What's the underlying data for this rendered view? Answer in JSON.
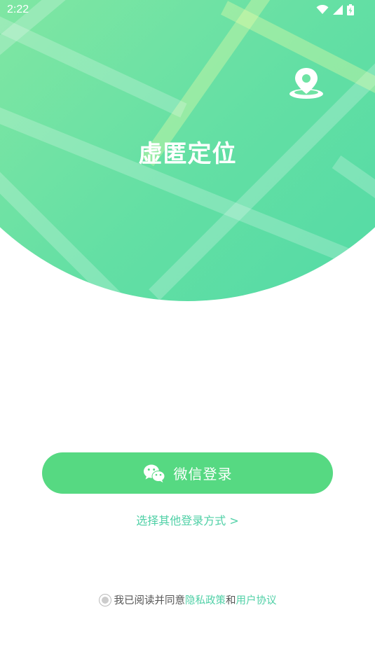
{
  "status_bar": {
    "time": "2:22"
  },
  "hero": {
    "app_title": "虚匿定位"
  },
  "login": {
    "wechat_button_label": "微信登录",
    "other_methods_link": "选择其他登录方式 >"
  },
  "agreement": {
    "prefix": "我已阅读并同意",
    "privacy_link": "隐私政策",
    "joiner": "和",
    "terms_link": "用户协议",
    "accepted": false
  },
  "colors": {
    "accent": "#56d982",
    "link": "#4fd0a6",
    "hero_gradient_start": "#a4f1a6",
    "hero_gradient_end": "#4fd9a6"
  }
}
